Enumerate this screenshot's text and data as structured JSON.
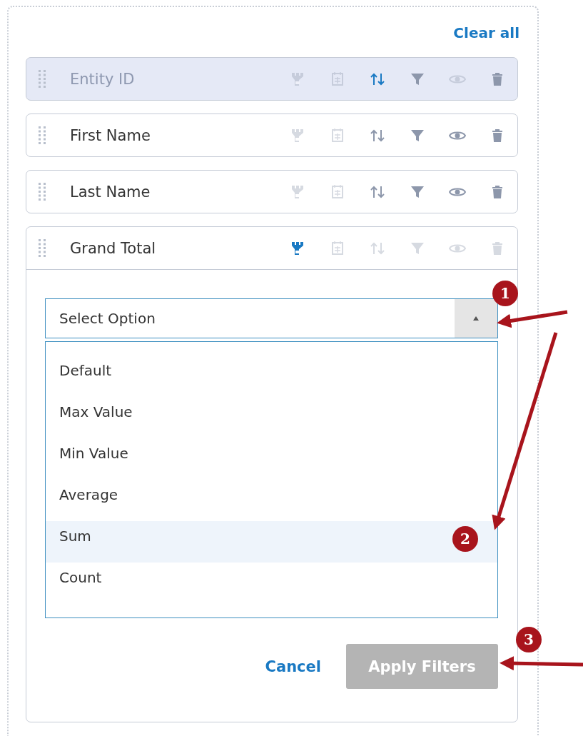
{
  "clear_all": "Clear all",
  "columns": [
    {
      "name": "Entity ID",
      "disabled": true,
      "expanded": false,
      "icons": [
        {
          "kind": "aggregate",
          "active": false,
          "disabled": true
        },
        {
          "kind": "calendar",
          "active": false,
          "disabled": true
        },
        {
          "kind": "sort",
          "active": true,
          "disabled": false
        },
        {
          "kind": "filter",
          "active": false,
          "disabled": false
        },
        {
          "kind": "visibility",
          "active": false,
          "disabled": true
        },
        {
          "kind": "delete",
          "active": false,
          "disabled": false
        }
      ]
    },
    {
      "name": "First Name",
      "disabled": false,
      "expanded": false,
      "icons": [
        {
          "kind": "aggregate",
          "active": false,
          "disabled": true
        },
        {
          "kind": "calendar",
          "active": false,
          "disabled": true
        },
        {
          "kind": "sort",
          "active": false,
          "disabled": false
        },
        {
          "kind": "filter",
          "active": false,
          "disabled": false
        },
        {
          "kind": "visibility",
          "active": false,
          "disabled": false
        },
        {
          "kind": "delete",
          "active": false,
          "disabled": false
        }
      ]
    },
    {
      "name": "Last Name",
      "disabled": false,
      "expanded": false,
      "icons": [
        {
          "kind": "aggregate",
          "active": false,
          "disabled": true
        },
        {
          "kind": "calendar",
          "active": false,
          "disabled": true
        },
        {
          "kind": "sort",
          "active": false,
          "disabled": false
        },
        {
          "kind": "filter",
          "active": false,
          "disabled": false
        },
        {
          "kind": "visibility",
          "active": false,
          "disabled": false
        },
        {
          "kind": "delete",
          "active": false,
          "disabled": false
        }
      ]
    },
    {
      "name": "Grand Total",
      "disabled": false,
      "expanded": true,
      "icons": [
        {
          "kind": "aggregate",
          "active": true,
          "disabled": false
        },
        {
          "kind": "calendar",
          "active": false,
          "disabled": true
        },
        {
          "kind": "sort",
          "active": false,
          "disabled": true
        },
        {
          "kind": "filter",
          "active": false,
          "disabled": true
        },
        {
          "kind": "visibility",
          "active": false,
          "disabled": true
        },
        {
          "kind": "delete",
          "active": false,
          "disabled": true
        }
      ]
    }
  ],
  "select": {
    "placeholder": "Select Option",
    "expanded": true,
    "options": [
      {
        "label": "Default",
        "selected": false
      },
      {
        "label": "Max Value",
        "selected": false
      },
      {
        "label": "Min Value",
        "selected": false
      },
      {
        "label": "Average",
        "selected": false
      },
      {
        "label": "Sum",
        "selected": true
      },
      {
        "label": "Count",
        "selected": false
      }
    ]
  },
  "buttons": [
    {
      "label": "Cancel",
      "kind": "link",
      "disabled": false
    },
    {
      "label": "Apply Filters",
      "kind": "primary",
      "disabled": true
    }
  ],
  "annotations": [
    {
      "label": "1"
    },
    {
      "label": "2"
    },
    {
      "label": "3"
    }
  ]
}
